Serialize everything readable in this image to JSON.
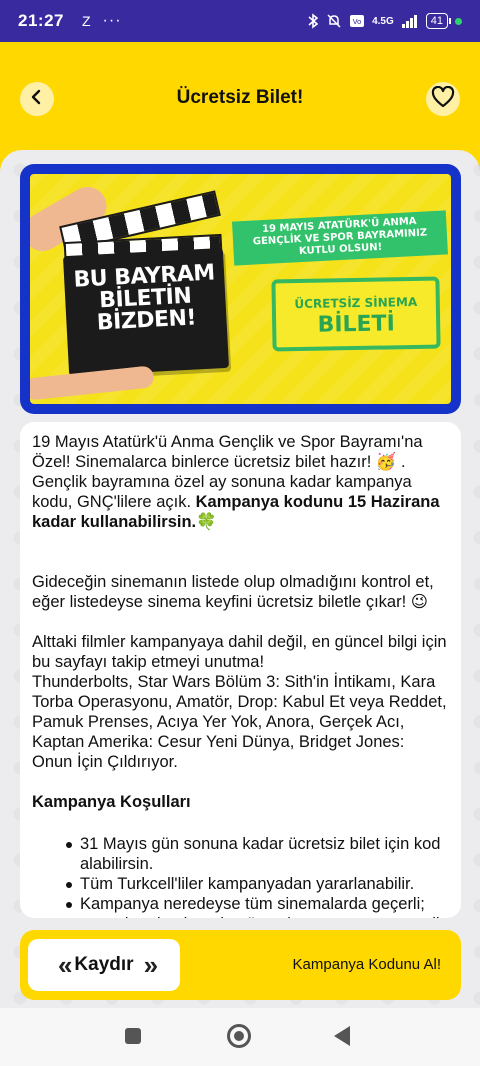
{
  "status_bar": {
    "time": "21:27",
    "z": "Z",
    "dots": "···",
    "network": "4.5G",
    "battery": "41"
  },
  "header": {
    "title": "Ücretsiz Bilet!"
  },
  "banner": {
    "clapboard_text": "BU BAYRAM BİLETİN BİZDEN!",
    "green_banner": "19 MAYIS ATATÜRK'Ü ANMA GENÇLİK VE SPOR BAYRAMINIZ KUTLU OLSUN!",
    "ticket_line1": "ÜCRETSİZ SİNEMA",
    "ticket_line2": "BİLETİ"
  },
  "content": {
    "intro": "19 Mayıs Atatürk'ü Anma Gençlik ve Spor Bayramı'na Özel!  Sinemalarca binlerce ücretsiz bilet hazır! 🥳 . Gençlik bayramına özel ay sonuna kadar kampanya kodu, GNÇ'lilere açık. ",
    "intro_bold": "Kampanya kodunu 15 Hazirana kadar kullanabilirsin.",
    "intro_emoji": "🍀",
    "check_cinema": "Gideceğin sinemanın listede olup olmadığını kontrol et, eğer listedeyse sinema keyfini ücretsiz biletle çıkar! 😉",
    "excluded_intro": "Alttaki filmler kampanyaya dahil değil, en güncel bilgi için bu sayfayı takip etmeyi unutma!",
    "excluded_list": "Thunderbolts, Star Wars Bölüm 3: Sith'in İntikamı, Kara Torba Operasyonu, Amatör, Drop: Kabul Et veya Reddet, Pamuk Prenses, Acıya Yer Yok, Anora, Gerçek Acı, Kaptan Amerika: Cesur Yeni Dünya, Bridget Jones: Onun İçin Çıldırıyor.",
    "conditions_title": "Kampanya Koşulları",
    "conditions": [
      "31 Mayıs gün sonuna kadar ücretsiz bilet için kod alabilirsin.",
      "Tüm Turkcell'liler kampanyadan yararlanabilir.",
      "Kampanya neredeyse tüm sinemalarda geçerli; ama yine de gitmeden önce kampanyanın geçerli"
    ]
  },
  "action_bar": {
    "slide_label": "Kaydır",
    "get_code_label": "Kampanya Kodunu Al!"
  },
  "colors": {
    "brand_yellow": "#ffd800",
    "status_purple": "#3a2aa0",
    "banner_blue": "#1533c9",
    "green": "#32c26b"
  }
}
